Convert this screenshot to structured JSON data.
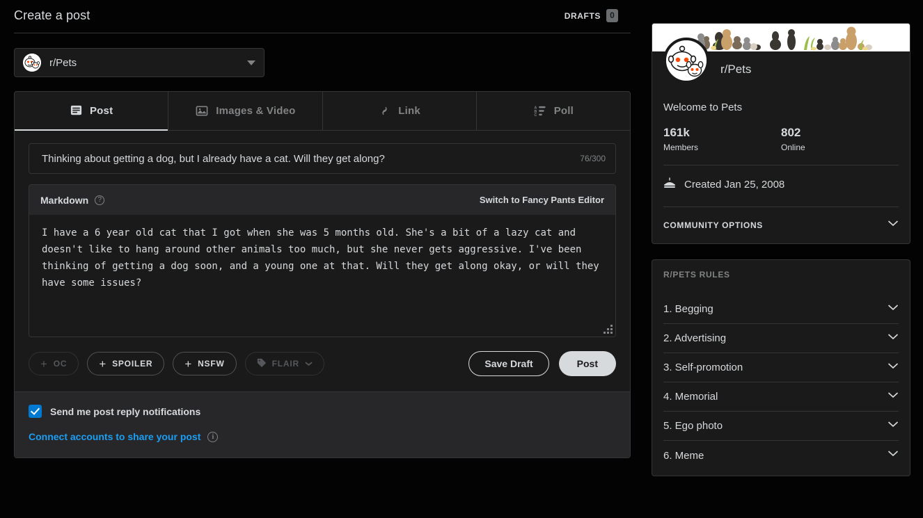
{
  "header": {
    "title": "Create a post",
    "drafts_label": "DRAFTS",
    "drafts_count": "0"
  },
  "subreddit_select": {
    "name": "r/Pets",
    "icon": "subreddit-avatar",
    "caret": "chevron-down-icon"
  },
  "tabs": [
    {
      "label": "Post",
      "icon": "post-icon",
      "active": true
    },
    {
      "label": "Images & Video",
      "icon": "image-icon",
      "active": false
    },
    {
      "label": "Link",
      "icon": "link-icon",
      "active": false
    },
    {
      "label": "Poll",
      "icon": "poll-icon",
      "active": false
    }
  ],
  "title_field": {
    "value": "Thinking about getting a dog, but I already have a cat. Will they get along?",
    "placeholder": "Title",
    "char_count": "76/300"
  },
  "editor": {
    "mode_label": "Markdown",
    "help_icon": "?",
    "switch_label": "Switch to Fancy Pants Editor",
    "body": "I have a 6 year old cat that I got when she was 5 months old. She's a bit of a lazy cat and doesn't like to hang around other animals too much, but she never gets aggressive. I've been thinking of getting a dog soon, and a young one at that. Will they get along okay, or will they have some issues?",
    "placeholder": "Text (optional)"
  },
  "actions": {
    "tags": [
      {
        "label": "OC",
        "icon": "plus-icon",
        "disabled": true
      },
      {
        "label": "SPOILER",
        "icon": "plus-icon",
        "disabled": false
      },
      {
        "label": "NSFW",
        "icon": "plus-icon",
        "disabled": false
      },
      {
        "label": "FLAIR",
        "icon": "tag-icon",
        "disabled": true
      }
    ],
    "save_draft_label": "Save Draft",
    "post_label": "Post"
  },
  "footer": {
    "notify_label": "Send me post reply notifications",
    "notify_checked": true,
    "connect_label": "Connect accounts to share your post",
    "info_icon": "i"
  },
  "community": {
    "name": "r/Pets",
    "welcome": "Welcome to Pets",
    "members_count": "161k",
    "members_label": "Members",
    "online_count": "802",
    "online_label": "Online",
    "created_text": "Created Jan 25, 2008",
    "cake_icon": "cake-icon",
    "options_label": "COMMUNITY OPTIONS"
  },
  "rules": {
    "title": "R/PETS RULES",
    "items": [
      {
        "label": "1. Begging"
      },
      {
        "label": "2. Advertising"
      },
      {
        "label": "3. Self-promotion"
      },
      {
        "label": "4. Memorial"
      },
      {
        "label": "5. Ego photo"
      },
      {
        "label": "6. Meme"
      }
    ]
  },
  "colors": {
    "page_bg": "#030303",
    "card_bg": "#1a1a1b",
    "panel_bg": "#272729",
    "border": "#343536",
    "text": "#d7dadc",
    "muted": "#818384",
    "accent_blue": "#0079d3",
    "link_blue": "#1b9ef3"
  }
}
